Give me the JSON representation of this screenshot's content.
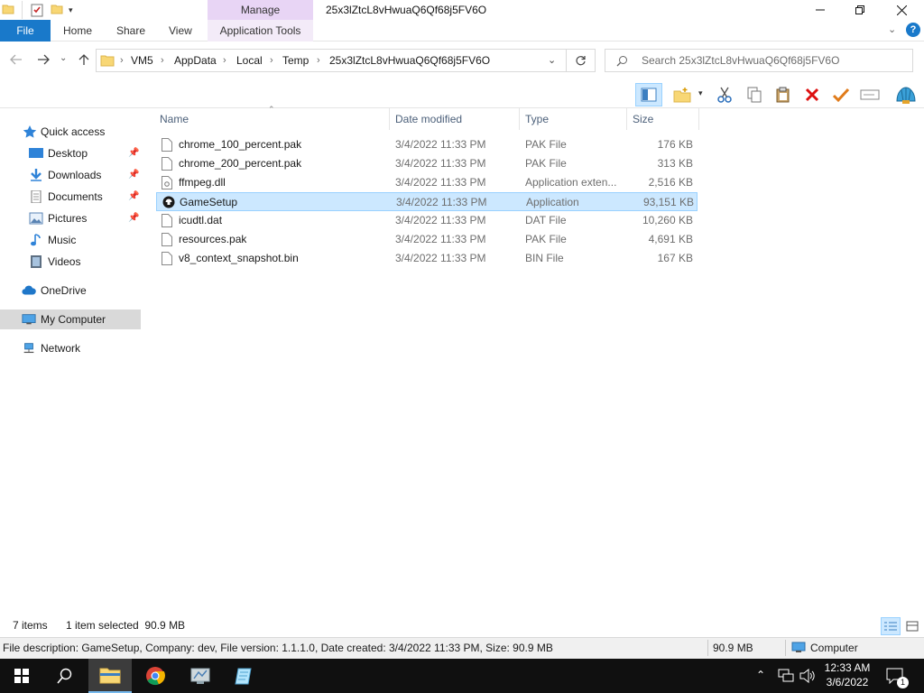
{
  "titlebar": {
    "manage_label": "Manage",
    "window_title": "25x3lZtcL8vHwuaQ6Qf68j5FV6O"
  },
  "ribbon": {
    "tabs": [
      "File",
      "Home",
      "Share",
      "View",
      "Application Tools"
    ]
  },
  "address": {
    "breadcrumbs": [
      "VM5",
      "AppData",
      "Local",
      "Temp",
      "25x3lZtcL8vHwuaQ6Qf68j5FV6O"
    ],
    "search_placeholder": "Search 25x3lZtcL8vHwuaQ6Qf68j5FV6O"
  },
  "navpane": {
    "items": [
      {
        "label": "Quick access",
        "icon": "star-icon"
      },
      {
        "label": "Desktop",
        "icon": "desktop-icon",
        "pinned": true
      },
      {
        "label": "Downloads",
        "icon": "download-icon",
        "pinned": true
      },
      {
        "label": "Documents",
        "icon": "documents-icon",
        "pinned": true
      },
      {
        "label": "Pictures",
        "icon": "pictures-icon",
        "pinned": true
      },
      {
        "label": "Music",
        "icon": "music-icon"
      },
      {
        "label": "Videos",
        "icon": "videos-icon"
      },
      {
        "label": "OneDrive",
        "icon": "cloud-icon"
      },
      {
        "label": "My Computer",
        "icon": "computer-icon",
        "selected": true
      },
      {
        "label": "Network",
        "icon": "network-icon"
      }
    ]
  },
  "filelist": {
    "columns": [
      "Name",
      "Date modified",
      "Type",
      "Size"
    ],
    "rows": [
      {
        "name": "chrome_100_percent.pak",
        "date": "3/4/2022 11:33 PM",
        "type": "PAK File",
        "size": "176 KB"
      },
      {
        "name": "chrome_200_percent.pak",
        "date": "3/4/2022 11:33 PM",
        "type": "PAK File",
        "size": "313 KB"
      },
      {
        "name": "ffmpeg.dll",
        "date": "3/4/2022 11:33 PM",
        "type": "Application exten...",
        "size": "2,516 KB"
      },
      {
        "name": "GameSetup",
        "date": "3/4/2022 11:33 PM",
        "type": "Application",
        "size": "93,151 KB",
        "selected": true
      },
      {
        "name": "icudtl.dat",
        "date": "3/4/2022 11:33 PM",
        "type": "DAT File",
        "size": "10,260 KB"
      },
      {
        "name": "resources.pak",
        "date": "3/4/2022 11:33 PM",
        "type": "PAK File",
        "size": "4,691 KB"
      },
      {
        "name": "v8_context_snapshot.bin",
        "date": "3/4/2022 11:33 PM",
        "type": "BIN File",
        "size": "167 KB"
      }
    ]
  },
  "status": {
    "item_count": "7 items",
    "selection": "1 item selected  90.9 MB"
  },
  "infobar": {
    "description": "File description: GameSetup, Company: dev, File version: 1.1.1.0, Date created: 3/4/2022 11:33 PM, Size: 90.9 MB",
    "size": "90.9 MB",
    "location": "Computer"
  },
  "taskbar": {
    "time": "12:33 AM",
    "date": "3/6/2022",
    "notification_count": "1"
  },
  "colors": {
    "file_tab": "#1979ca",
    "manage_tab": "#e8d5f5",
    "selection": "#cce8ff",
    "taskbar": "#101010"
  }
}
